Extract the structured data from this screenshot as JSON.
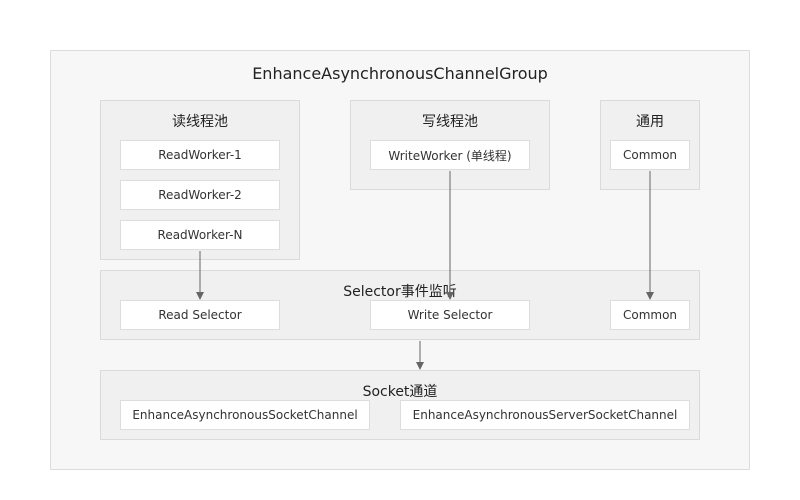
{
  "title": "EnhanceAsynchronousChannelGroup",
  "read_pool": {
    "title": "读线程池",
    "workers": [
      "ReadWorker-1",
      "ReadWorker-2",
      "ReadWorker-N"
    ]
  },
  "write_pool": {
    "title": "写线程池",
    "worker": "WriteWorker (单线程)"
  },
  "common_pool": {
    "title": "通用",
    "item": "Common"
  },
  "selector": {
    "title": "Selector事件监听",
    "read": "Read Selector",
    "write": "Write Selector",
    "common": "Common"
  },
  "socket": {
    "title": "Socket通道",
    "channel": "EnhanceAsynchronousSocketChannel",
    "server_channel": "EnhanceAsynchronousServerSocketChannel"
  }
}
